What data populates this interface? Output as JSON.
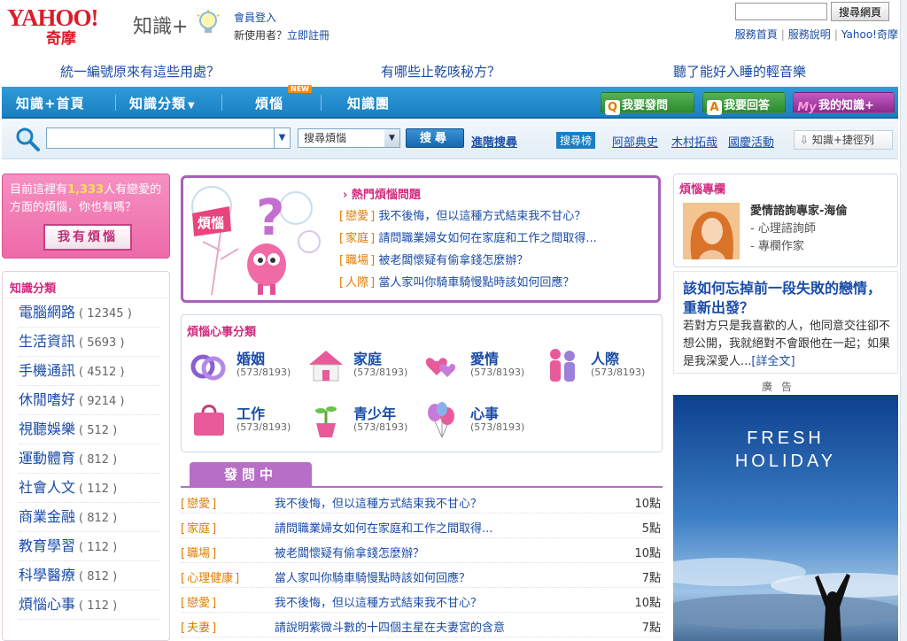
{
  "header": {
    "logo_text": "YAHOO!",
    "logo_sub": "奇摩",
    "product": "知識+",
    "member_login": "會員登入",
    "new_user_prefix": "新使用者？",
    "register": "立即註冊",
    "search_button": "搜尋網頁",
    "top_links": [
      "服務首頁",
      "服務說明",
      "Yahoo!奇摩"
    ],
    "promos": [
      "統一編號原來有這些用處？",
      "有哪些止乾咳秘方？",
      "聽了能好入睡的輕音樂"
    ]
  },
  "nav": {
    "items": [
      "知識+首頁",
      "知識分類",
      "煩惱",
      "知識團"
    ],
    "new_badge": "NEW",
    "ask": "我要發問",
    "answer": "我要回答",
    "my": "我的知識+",
    "ask_icon": "Q",
    "answer_icon": "A",
    "my_icon": "My"
  },
  "search": {
    "input_value": "",
    "category_select": "搜尋煩惱",
    "go": "搜尋",
    "advanced": "進階搜尋",
    "rank_label": "搜尋榜",
    "rank_links": [
      "阿部典史",
      "木村拓哉",
      "國慶活動"
    ],
    "shortcut": "知識+捷徑列"
  },
  "worry": {
    "prefix": "目前這裡有",
    "count": "1,333",
    "suffix": "人有戀愛的方面的煩惱，你也有嗎？",
    "button": "我有煩惱"
  },
  "categories": {
    "title": "知識分類",
    "items": [
      {
        "name": "電腦網路",
        "count": "( 12345 )"
      },
      {
        "name": "生活資訊",
        "count": "( 5693 )"
      },
      {
        "name": "手機通訊",
        "count": "( 4512 )"
      },
      {
        "name": "休閒嗜好",
        "count": "( 9214 )"
      },
      {
        "name": "視聽娛樂",
        "count": "( 512 )"
      },
      {
        "name": "運動體育",
        "count": "( 812 )"
      },
      {
        "name": "社會人文",
        "count": "( 112 )"
      },
      {
        "name": "商業金融",
        "count": "( 812 )"
      },
      {
        "name": "教育學習",
        "count": "( 112 )"
      },
      {
        "name": "科學醫療",
        "count": "( 812 )"
      },
      {
        "name": "煩惱心事",
        "count": "( 112 )"
      }
    ]
  },
  "hot": {
    "illus_label": "煩惱",
    "title": "熱門煩惱問題",
    "rows": [
      {
        "tag": "戀愛",
        "text": "我不後悔，但以這種方式結束我不甘心？"
      },
      {
        "tag": "家庭",
        "text": "請問職業婦女如何在家庭和工作之間取得..."
      },
      {
        "tag": "職場",
        "text": "被老闆懷疑有偷拿錢怎麼辦？"
      },
      {
        "tag": "人際",
        "text": "當人家叫你騎車騎慢點時該如何回應？"
      }
    ]
  },
  "worry_cats": {
    "title": "煩惱心事分類",
    "items": [
      {
        "name": "婚姻",
        "sub": "(573/8193)",
        "icon": "rings-icon"
      },
      {
        "name": "家庭",
        "sub": "(573/8193)",
        "icon": "house-icon"
      },
      {
        "name": "愛情",
        "sub": "(573/8193)",
        "icon": "hearts-icon"
      },
      {
        "name": "人際",
        "sub": "(573/8193)",
        "icon": "people-icon"
      },
      {
        "name": "工作",
        "sub": "(573/8193)",
        "icon": "bag-icon"
      },
      {
        "name": "青少年",
        "sub": "(573/8193)",
        "icon": "sprout-icon"
      },
      {
        "name": "心事",
        "sub": "(573/8193)",
        "icon": "balloons-icon"
      }
    ]
  },
  "asking": {
    "tab": "發問中",
    "rows": [
      {
        "tag": "戀愛",
        "q": "我不後悔，但以這種方式結束我不甘心？",
        "pts": "10點"
      },
      {
        "tag": "家庭",
        "q": "請問職業婦女如何在家庭和工作之間取得...",
        "pts": "5點"
      },
      {
        "tag": "職場",
        "q": "被老闆懷疑有偷拿錢怎麼辦？",
        "pts": "10點"
      },
      {
        "tag": "心理健康",
        "q": "當人家叫你騎車騎慢點時該如何回應？",
        "pts": "7點"
      },
      {
        "tag": "戀愛",
        "q": "我不後悔，但以這種方式結束我不甘心？",
        "pts": "10點"
      },
      {
        "tag": "夫妻",
        "q": "請說明紫微斗數的十四個主星在夫妻宮的含意",
        "pts": "7點"
      }
    ]
  },
  "column": {
    "title": "煩惱專欄",
    "name": "愛情諮詢專家-海倫",
    "roles": [
      "- 心理諮詢師",
      "- 專欄作家"
    ],
    "article_title": "該如何忘掉前一段失敗的戀情，重新出發？",
    "article_body": "若對方只是我喜歡的人，他同意交往卻不想公開，我就絕對不會跟他在一起；如果是我深愛人...",
    "read_more": "[詳全文]"
  },
  "ad": {
    "label": "廣告",
    "line1": "FRESH",
    "line2": "HOLIDAY"
  }
}
